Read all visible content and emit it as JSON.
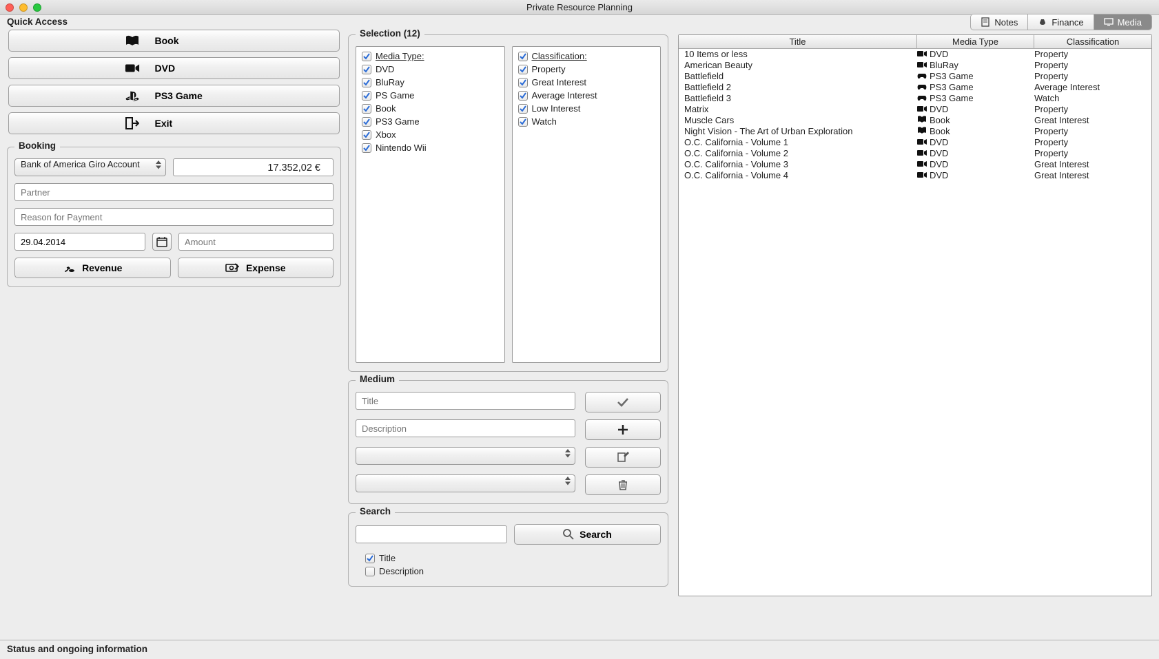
{
  "window": {
    "title": "Private Resource Planning"
  },
  "quick_access": {
    "title": "Quick Access",
    "buttons": {
      "book": "Book",
      "dvd": "DVD",
      "ps3": "PS3 Game",
      "exit": "Exit"
    }
  },
  "booking": {
    "title": "Booking",
    "account": "Bank of America Giro Account",
    "balance": "17.352,02 €",
    "partner_ph": "Partner",
    "reason_ph": "Reason for Payment",
    "date": "29.04.2014",
    "amount_ph": "Amount",
    "revenue": "Revenue",
    "expense": "Expense"
  },
  "tabs": {
    "notes": "Notes",
    "finance": "Finance",
    "media": "Media"
  },
  "selection": {
    "title": "Selection (12)",
    "media_type_label": "Media Type:",
    "classification_label": "Classification:",
    "media_types": [
      "DVD",
      "BluRay",
      "PS Game",
      "Book",
      "PS3 Game",
      "Xbox",
      "Nintendo Wii"
    ],
    "classifications": [
      "Property",
      "Great Interest",
      "Average Interest",
      "Low Interest",
      "Watch"
    ]
  },
  "media_table": {
    "headers": {
      "title": "Title",
      "media_type": "Media Type",
      "classification": "Classification"
    },
    "rows": [
      {
        "title": "10 Items or less",
        "type": "DVD",
        "cls": "Property"
      },
      {
        "title": "American Beauty",
        "type": "BluRay",
        "cls": "Property"
      },
      {
        "title": "Battlefield",
        "type": "PS3 Game",
        "cls": "Property"
      },
      {
        "title": "Battlefield 2",
        "type": "PS3 Game",
        "cls": "Average Interest"
      },
      {
        "title": "Battlefield 3",
        "type": "PS3 Game",
        "cls": "Watch"
      },
      {
        "title": "Matrix",
        "type": "DVD",
        "cls": "Property"
      },
      {
        "title": "Muscle Cars",
        "type": "Book",
        "cls": "Great Interest"
      },
      {
        "title": "Night Vision - The Art of Urban Exploration",
        "type": "Book",
        "cls": "Property"
      },
      {
        "title": "O.C. California - Volume 1",
        "type": "DVD",
        "cls": "Property"
      },
      {
        "title": "O.C. California - Volume 2",
        "type": "DVD",
        "cls": "Property"
      },
      {
        "title": "O.C. California - Volume 3",
        "type": "DVD",
        "cls": "Great Interest"
      },
      {
        "title": "O.C. California - Volume 4",
        "type": "DVD",
        "cls": "Great Interest"
      }
    ]
  },
  "medium": {
    "title": "Medium",
    "title_ph": "Title",
    "desc_ph": "Description"
  },
  "search": {
    "title": "Search",
    "button": "Search",
    "by_title": "Title",
    "by_desc": "Description"
  },
  "statusbar": "Status and ongoing information"
}
